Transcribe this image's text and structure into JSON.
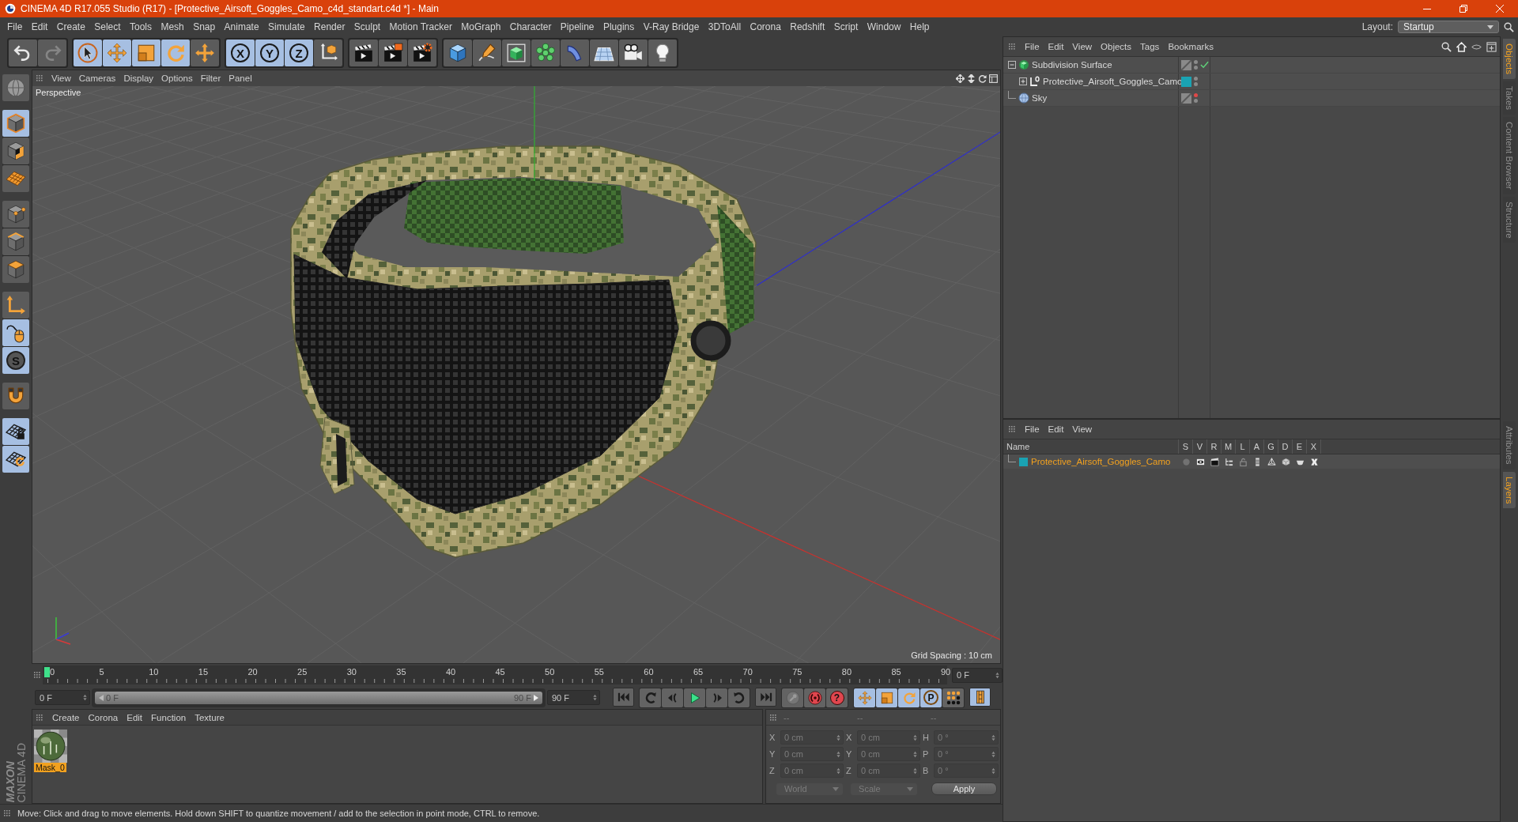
{
  "window": {
    "title": "CINEMA 4D R17.055 Studio (R17) - [Protective_Airsoft_Goggles_Camo_c4d_standart.c4d *] - Main"
  },
  "menu_bar": {
    "items": [
      "File",
      "Edit",
      "Create",
      "Select",
      "Tools",
      "Mesh",
      "Snap",
      "Animate",
      "Simulate",
      "Render",
      "Sculpt",
      "Motion Tracker",
      "MoGraph",
      "Character",
      "Pipeline",
      "Plugins",
      "V-Ray Bridge",
      "3DToAll",
      "Corona",
      "Redshift",
      "Script",
      "Window",
      "Help"
    ],
    "layout_label": "Layout:",
    "layout_value": "Startup"
  },
  "toolbar": {
    "groups": [
      [
        {
          "kind": "undo",
          "active": false,
          "disabled": false
        },
        {
          "kind": "redo",
          "active": false,
          "disabled": true
        }
      ],
      [
        {
          "kind": "select",
          "active": true,
          "disabled": false
        },
        {
          "kind": "move",
          "active": true,
          "disabled": false
        },
        {
          "kind": "scale",
          "active": true,
          "disabled": false
        },
        {
          "kind": "rotate",
          "active": true,
          "disabled": false
        },
        {
          "kind": "transform",
          "active": false,
          "disabled": false
        }
      ],
      [
        {
          "kind": "axis",
          "label": "X",
          "active": true,
          "disabled": false
        },
        {
          "kind": "axis",
          "label": "Y",
          "active": true,
          "disabled": false
        },
        {
          "kind": "axis",
          "label": "Z",
          "active": true,
          "disabled": false
        },
        {
          "kind": "coords",
          "active": false,
          "disabled": false
        }
      ],
      [
        {
          "kind": "render-view",
          "active": false,
          "disabled": false
        },
        {
          "kind": "render-viewer",
          "active": false,
          "disabled": false
        },
        {
          "kind": "render-settings",
          "active": false,
          "disabled": false
        }
      ],
      [
        {
          "kind": "cube",
          "active": false,
          "disabled": false
        },
        {
          "kind": "pen",
          "active": false,
          "disabled": false
        },
        {
          "kind": "subdivision",
          "active": false,
          "disabled": false
        },
        {
          "kind": "cloner",
          "active": false,
          "disabled": false
        },
        {
          "kind": "deformer",
          "active": false,
          "disabled": false
        },
        {
          "kind": "floor",
          "active": false,
          "disabled": false
        },
        {
          "kind": "camera",
          "active": false,
          "disabled": false
        },
        {
          "kind": "light",
          "active": false,
          "disabled": false
        }
      ]
    ]
  },
  "left_tools": {
    "groups": [
      [
        {
          "kind": "sphere",
          "active": false
        }
      ],
      [
        {
          "kind": "model",
          "active": true
        },
        {
          "kind": "texture",
          "active": false
        },
        {
          "kind": "workplane",
          "active": false
        }
      ],
      [
        {
          "kind": "points",
          "active": false
        },
        {
          "kind": "edges",
          "active": false
        },
        {
          "kind": "polygons",
          "active": false
        }
      ],
      [
        {
          "kind": "axis-mode",
          "active": false
        },
        {
          "kind": "tweak",
          "active": true
        },
        {
          "kind": "snap",
          "label": "S",
          "active": true
        }
      ],
      [
        {
          "kind": "magnet",
          "active": false
        }
      ],
      [
        {
          "kind": "grid-lock",
          "active": true
        },
        {
          "kind": "grid-sync",
          "active": true
        }
      ]
    ]
  },
  "logo": {
    "brand": "MAXON",
    "product": "CINEMA 4D"
  },
  "viewport": {
    "menu": [
      "View",
      "Cameras",
      "Display",
      "Options",
      "Filter",
      "Panel"
    ],
    "camera": "Perspective",
    "grid_spacing": "Grid Spacing : 10 cm"
  },
  "timeline": {
    "labels": [
      "0",
      "5",
      "10",
      "15",
      "20",
      "25",
      "30",
      "35",
      "40",
      "45",
      "50",
      "55",
      "60",
      "65",
      "70",
      "75",
      "80",
      "85",
      "90"
    ],
    "playhead": {
      "level": 0
    },
    "frame_field": "0 F"
  },
  "range": {
    "start_field": "0 F",
    "slider_start": "0 F",
    "slider_end": "90 F",
    "end_field": "90 F",
    "level": 1
  },
  "playback": {
    "groups": [
      [
        {
          "kind": "go-start",
          "active": false
        }
      ],
      [
        {
          "kind": "prev-key",
          "active": false
        },
        {
          "kind": "prev-frame",
          "active": false
        },
        {
          "kind": "play",
          "active": false
        },
        {
          "kind": "next-frame",
          "active": false
        },
        {
          "kind": "next-key",
          "active": false
        }
      ],
      [
        {
          "kind": "go-end",
          "active": false
        }
      ],
      [
        {
          "kind": "record-key",
          "active": false
        },
        {
          "kind": "autokey",
          "active": false
        },
        {
          "kind": "keyframe-selection",
          "label": "?",
          "active": false
        }
      ],
      [
        {
          "kind": "key-move",
          "active": true
        },
        {
          "kind": "key-scale",
          "active": true
        },
        {
          "kind": "key-rotate",
          "active": true
        },
        {
          "kind": "key-param",
          "label": "P",
          "active": true
        },
        {
          "kind": "key-pla",
          "active": false
        }
      ],
      [
        {
          "kind": "timeline",
          "active": true
        }
      ]
    ]
  },
  "materials": {
    "menu": [
      "Create",
      "Corona",
      "Edit",
      "Function",
      "Texture"
    ],
    "items": [
      {
        "name": "Mask_0",
        "selected": true
      }
    ]
  },
  "coordinates": {
    "headers": [
      "--",
      "--",
      "--"
    ],
    "rows": [
      {
        "p_axis": "X",
        "position": "0 cm",
        "s_axis": "X",
        "size": "0 cm",
        "r_axis": "H",
        "rotation": "0 °"
      },
      {
        "p_axis": "Y",
        "position": "0 cm",
        "s_axis": "Y",
        "size": "0 cm",
        "r_axis": "P",
        "rotation": "0 °"
      },
      {
        "p_axis": "Z",
        "position": "0 cm",
        "s_axis": "Z",
        "size": "0 cm",
        "r_axis": "B",
        "rotation": "0 °"
      }
    ],
    "mode": "World",
    "size_mode": "Scale",
    "apply": "Apply",
    "disabled": true
  },
  "object_manager": {
    "menu": [
      "File",
      "Edit",
      "View",
      "Objects",
      "Tags",
      "Bookmarks"
    ],
    "objects": [
      {
        "name": "Subdivision Surface",
        "kind": "subdivision",
        "expanded": true,
        "enabled": true,
        "editor_hidden": false,
        "children": [
          {
            "name": "Protective_Airsoft_Goggles_Camo",
            "kind": "null",
            "expanded": false,
            "color": "#1aa3b3",
            "editor_hidden": false
          }
        ]
      },
      {
        "name": "Sky",
        "kind": "sky",
        "editor_hidden": true
      }
    ]
  },
  "layer_manager": {
    "menu": [
      "File",
      "Edit",
      "View"
    ],
    "columns": [
      "Name",
      "S",
      "V",
      "R",
      "M",
      "L",
      "A",
      "G",
      "D",
      "E",
      "X"
    ],
    "layers": [
      {
        "name": "Protective_Airsoft_Goggles_Camo",
        "color": "#1aa3b3",
        "selected": true,
        "flags": [
          {
            "kind": "solo",
            "on": false
          },
          {
            "kind": "view",
            "on": true
          },
          {
            "kind": "render",
            "on": true
          },
          {
            "kind": "manager",
            "on": true
          },
          {
            "kind": "lock",
            "on": false
          },
          {
            "kind": "animation",
            "on": true
          },
          {
            "kind": "generators",
            "on": true
          },
          {
            "kind": "deformers",
            "on": true
          },
          {
            "kind": "expressions",
            "on": true
          },
          {
            "kind": "xref",
            "on": true
          }
        ]
      }
    ]
  },
  "side_tabs": {
    "top": [
      {
        "label": "Objects",
        "selected": true
      },
      {
        "label": "Takes",
        "selected": false
      },
      {
        "label": "Content Browser",
        "selected": false
      },
      {
        "label": "Structure",
        "selected": false
      }
    ],
    "bottom": [
      {
        "label": "Attributes",
        "selected": false
      },
      {
        "label": "Layers",
        "selected": true
      }
    ]
  },
  "status_bar": {
    "text": "Move: Click and drag to move elements. Hold down SHIFT to quantize movement / add to the selection in point mode, CTRL to remove."
  }
}
